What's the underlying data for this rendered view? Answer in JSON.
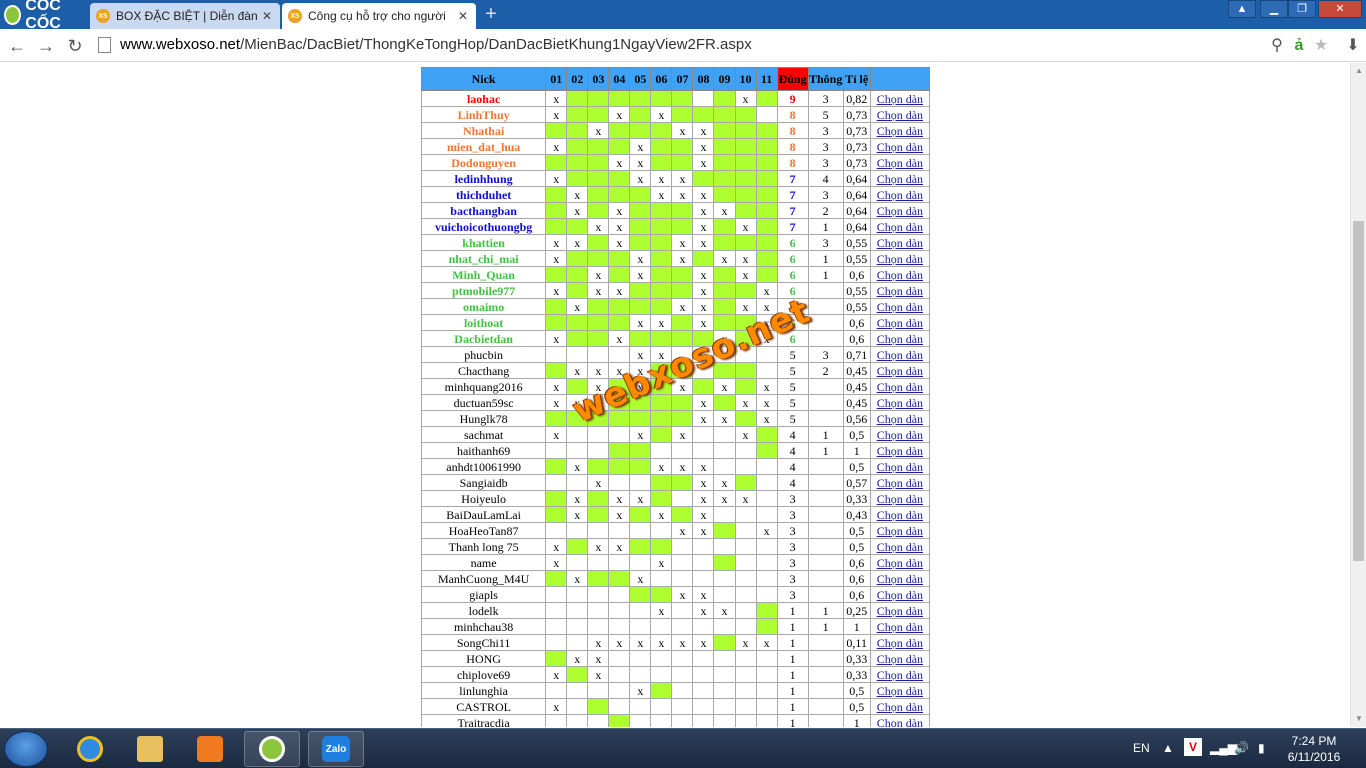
{
  "browser": {
    "brand": "CỐC CỐC",
    "tabs": [
      {
        "favicon": "XS",
        "title": "BOX ĐẶC BIỆT | Diễn đàn"
      },
      {
        "favicon": "XS",
        "title": "Công cụ hỗ trợ cho người"
      }
    ],
    "url_host": "www.webxoso.net",
    "url_path": "/MienBac/DacBiet/ThongKeTongHop/DanDacBietKhung1NgayView2FR.aspx"
  },
  "table": {
    "headers": [
      "Nick",
      "01",
      "02",
      "03",
      "04",
      "05",
      "06",
      "07",
      "08",
      "09",
      "10",
      "11",
      "Đúng",
      "Thông",
      "Tỉ lệ",
      ""
    ],
    "action_label": "Chọn dàn",
    "rows": [
      {
        "nick": "laohac",
        "color": "red",
        "marks": "x--------x---",
        "fill": "-gggggg-ggg",
        "dung": "9",
        "thong": "3",
        "ratio": "0,82"
      },
      {
        "nick": "LinhThuy",
        "color": "orange",
        "marks": "x--x-x-----",
        "fill": "-gg-g-gggg",
        "dung": "8",
        "thong": "5",
        "ratio": "0,73"
      },
      {
        "nick": "Nhathai",
        "color": "orange",
        "marks": "--x---xx---",
        "fill": "gg-ggg--ggg",
        "dung": "8",
        "thong": "3",
        "ratio": "0,73"
      },
      {
        "nick": "mien_dat_hua",
        "color": "orange",
        "marks": "x---x--x---",
        "fill": "-ggg-gg-ggg",
        "dung": "8",
        "thong": "3",
        "ratio": "0,73"
      },
      {
        "nick": "Dodonguyen",
        "color": "orange",
        "marks": "---xx--x---",
        "fill": "ggg--gg-ggg",
        "dung": "8",
        "thong": "3",
        "ratio": "0,73"
      },
      {
        "nick": "ledinhhung",
        "color": "blue",
        "marks": "x---xxx----",
        "fill": "-ggg---gggg",
        "dung": "7",
        "thong": "4",
        "ratio": "0,64"
      },
      {
        "nick": "thichduhet",
        "color": "blue",
        "marks": "-x---xxx---",
        "fill": "g-ggg---ggg",
        "dung": "7",
        "thong": "3",
        "ratio": "0,64"
      },
      {
        "nick": "bacthangban",
        "color": "blue",
        "marks": "-x-x---xx--",
        "fill": "g-g-ggg--gg",
        "dung": "7",
        "thong": "2",
        "ratio": "0,64"
      },
      {
        "nick": "vuichoicothuongbg",
        "color": "blue",
        "marks": "--xx---x-x-",
        "fill": "gg--ggg-g-g",
        "dung": "7",
        "thong": "1",
        "ratio": "0,64"
      },
      {
        "nick": "khattien",
        "color": "green",
        "marks": "xx-x--xx---",
        "fill": "--g-gg--ggg",
        "dung": "6",
        "thong": "3",
        "ratio": "0,55"
      },
      {
        "nick": "nhat_chi_mai",
        "color": "green",
        "marks": "x---x-x-xx-",
        "fill": "-ggg-g-g--g",
        "dung": "6",
        "thong": "1",
        "ratio": "0,55"
      },
      {
        "nick": "Minh_Quan",
        "color": "green",
        "marks": "--x-x--x-x-",
        "fill": "gg-g-gg-g-g",
        "dung": "6",
        "thong": "1",
        "ratio": "0,6"
      },
      {
        "nick": "ptmobile977",
        "color": "green",
        "marks": "x-xx---x--x",
        "fill": "-g--ggg-gg-",
        "dung": "6",
        "thong": "",
        "ratio": "0,55"
      },
      {
        "nick": "omaimo",
        "color": "green",
        "marks": "-x----xx-xx",
        "fill": "g-gggg--g--",
        "dung": "6",
        "thong": "",
        "ratio": "0,55"
      },
      {
        "nick": "loithoat",
        "color": "green",
        "marks": "----xx-x--x",
        "fill": "gggg--g-gg-",
        "dung": "6",
        "thong": "",
        "ratio": "0,6"
      },
      {
        "nick": "Dacbietdan",
        "color": "green",
        "marks": "x--x----x-x",
        "fill": "-gg-gggg-g-",
        "dung": "6",
        "thong": "",
        "ratio": "0,6"
      },
      {
        "nick": "phucbin",
        "color": "black",
        "marks": "----xx-----",
        "fill": "----------",
        "dung": "5",
        "thong": "3",
        "ratio": "0,71"
      },
      {
        "nick": "Chacthang",
        "color": "black",
        "marks": "-xxxx------",
        "fill": "g----gg-gg",
        "dung": "5",
        "thong": "2",
        "ratio": "0,45"
      },
      {
        "nick": "minhquang2016",
        "color": "black",
        "marks": "x-x-x-x-x-x",
        "fill": "-g-g-g-g-g-",
        "dung": "5",
        "thong": "",
        "ratio": "0,45"
      },
      {
        "nick": "ductuan59sc",
        "color": "black",
        "marks": "xxx----x-xx",
        "fill": "---gggg-g--",
        "dung": "5",
        "thong": "",
        "ratio": "0,45"
      },
      {
        "nick": "Hunglk78",
        "color": "black",
        "marks": "-------xx-x",
        "fill": "ggggggg--g-",
        "dung": "5",
        "thong": "",
        "ratio": "0,56"
      },
      {
        "nick": "sachmat",
        "color": "black",
        "marks": "x---x-x--x-",
        "fill": "-----g----g",
        "dung": "4",
        "thong": "1",
        "ratio": "0,5"
      },
      {
        "nick": "haithanh69",
        "color": "black",
        "marks": "-----------",
        "fill": "---gg-----g",
        "dung": "4",
        "thong": "1",
        "ratio": "1"
      },
      {
        "nick": "anhdt10061990",
        "color": "black",
        "marks": "-x---xxx---",
        "fill": "g-ggg------",
        "dung": "4",
        "thong": "",
        "ratio": "0,5"
      },
      {
        "nick": "Sangiaidb",
        "color": "black",
        "marks": "--x----xx--",
        "fill": "-----gg--g-",
        "dung": "4",
        "thong": "",
        "ratio": "0,57"
      },
      {
        "nick": "Hoiyeulo",
        "color": "black",
        "marks": "-x-xx--xxx-",
        "fill": "g-g--g----",
        "dung": "3",
        "thong": "",
        "ratio": "0,33"
      },
      {
        "nick": "BaiDauLamLai",
        "color": "black",
        "marks": "-x-x-x-x---",
        "fill": "g-g-g-g----",
        "dung": "3",
        "thong": "",
        "ratio": "0,43"
      },
      {
        "nick": "HoaHeoTan87",
        "color": "black",
        "marks": "------xx--x",
        "fill": "-------gg--",
        "dung": "3",
        "thong": "",
        "ratio": "0,5"
      },
      {
        "nick": "Thanh long 75",
        "color": "black",
        "marks": "x-xx-------",
        "fill": "-g--gg-----",
        "dung": "3",
        "thong": "",
        "ratio": "0,5"
      },
      {
        "nick": "name",
        "color": "black",
        "marks": "x----x-----",
        "fill": "--------g--",
        "dung": "3",
        "thong": "",
        "ratio": "0,6"
      },
      {
        "nick": "ManhCuong_M4U",
        "color": "black",
        "marks": "-x--x------",
        "fill": "g-gg-------",
        "dung": "3",
        "thong": "",
        "ratio": "0,6"
      },
      {
        "nick": "giapls",
        "color": "black",
        "marks": "------xx---",
        "fill": "----gg-----",
        "dung": "3",
        "thong": "",
        "ratio": "0,6"
      },
      {
        "nick": "lodelk",
        "color": "black",
        "marks": "-----x-xx--",
        "fill": "----------g",
        "dung": "1",
        "thong": "1",
        "ratio": "0,25"
      },
      {
        "nick": "minhchau38",
        "color": "black",
        "marks": "-----------",
        "fill": "----------g",
        "dung": "1",
        "thong": "1",
        "ratio": "1"
      },
      {
        "nick": "SongChi11",
        "color": "black",
        "marks": "--xxxxxx-xx",
        "fill": "--------g--",
        "dung": "1",
        "thong": "",
        "ratio": "0,11"
      },
      {
        "nick": "HONG",
        "color": "black",
        "marks": "-xx--------",
        "fill": "g----------",
        "dung": "1",
        "thong": "",
        "ratio": "0,33"
      },
      {
        "nick": "chiplove69",
        "color": "black",
        "marks": "x-x--------",
        "fill": "-g---------",
        "dung": "1",
        "thong": "",
        "ratio": "0,33"
      },
      {
        "nick": "linlunghia",
        "color": "black",
        "marks": "----x------",
        "fill": "-----g-----",
        "dung": "1",
        "thong": "",
        "ratio": "0,5"
      },
      {
        "nick": "CASTROL",
        "color": "black",
        "marks": "x----------",
        "fill": "--g--------",
        "dung": "1",
        "thong": "",
        "ratio": "0,5"
      },
      {
        "nick": "Traitracdia",
        "color": "black",
        "marks": "-----------",
        "fill": "---g-------",
        "dung": "1",
        "thong": "",
        "ratio": "1"
      }
    ]
  },
  "watermark": "webxoso.net",
  "taskbar": {
    "zalo_label": "Zalo",
    "lang": "EN",
    "time": "7:24 PM",
    "date": "6/11/2016"
  },
  "icons": {
    "back": "back-arrow-icon",
    "forward": "forward-arrow-icon",
    "reload": "reload-icon",
    "zoom": "zoom-icon",
    "dictionary": "dictionary-icon",
    "star": "bookmark-star-icon",
    "download": "download-icon"
  }
}
